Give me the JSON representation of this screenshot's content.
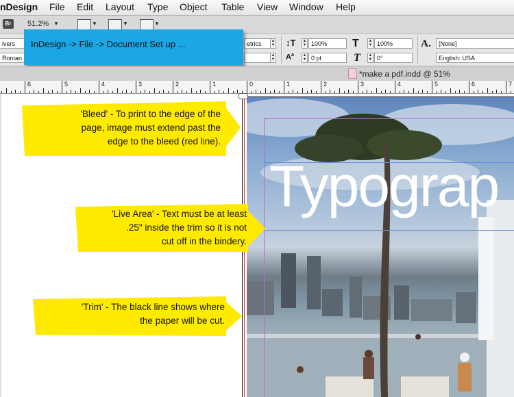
{
  "menubar": {
    "app_name": "nDesign",
    "items": [
      "File",
      "Edit",
      "Layout",
      "Type",
      "Object",
      "Table",
      "View",
      "Window",
      "Help"
    ]
  },
  "apptools": {
    "bridge_label": "Br",
    "zoom": "51.2%"
  },
  "control_panel": {
    "font_family": "ivers",
    "font_style": "Roman",
    "kerning": "etrics",
    "vertical_scale": "100%",
    "horizontal_scale": "100%",
    "baseline_shift": "0 pt",
    "skew": "0°",
    "character_style": "[None]",
    "language": "English: USA"
  },
  "callouts": {
    "menu_path": "InDesign -> File ->  Document  Set up ...",
    "bleed": [
      "'Bleed' - To print to the edge of the",
      "page, image must extend past the",
      "edge to the bleed (red line)."
    ],
    "live_area": [
      "'Live Area' - Text must be at least",
      ".25\" inside the trim so it is not",
      "cut off in the bindery."
    ],
    "trim": [
      "'Trim' - The black line shows where",
      "the paper will be cut."
    ]
  },
  "document": {
    "tab_title": "*make a pdf.indd @ 51%",
    "headline": "Typograp"
  },
  "ruler": {
    "labels": [
      "6",
      "5",
      "4",
      "3",
      "2",
      "1",
      "0",
      "1",
      "2",
      "3",
      "4",
      "5",
      "6",
      "7"
    ]
  },
  "colors": {
    "callout_blue": "#1ba6e5",
    "callout_yellow": "#ffea00",
    "bleed_line": "#e0292a",
    "margin_guide": "#b66ad9",
    "column_guide": "#6a8fdc"
  }
}
